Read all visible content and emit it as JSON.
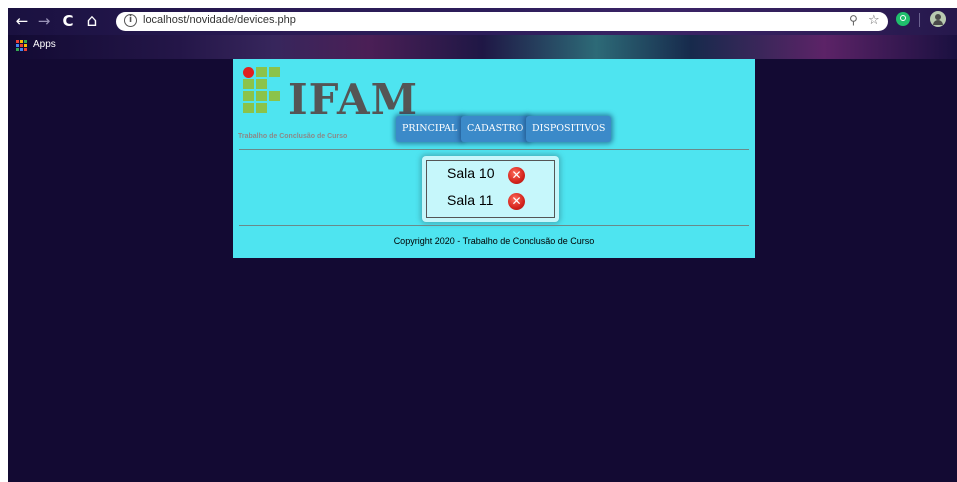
{
  "browser": {
    "url": "localhost/novidade/devices.php",
    "back_icon": "←",
    "forward_icon": "→",
    "reload_icon": "C",
    "home_icon": "⌂",
    "info_icon": "i",
    "zoom_icon": "⚲",
    "star_icon": "☆",
    "bookmarks": {
      "apps_label": "Apps"
    }
  },
  "site": {
    "logo_text": "IFAM",
    "subtitle": "Trabalho de Conclusão de Curso",
    "menu": [
      {
        "label": "PRINCIPAL"
      },
      {
        "label": "CADASTRO"
      },
      {
        "label": "DISPOSITIVOS"
      }
    ],
    "devices": [
      {
        "name": "Sala 10",
        "delete_icon": "✕"
      },
      {
        "name": "Sala 11",
        "delete_icon": "✕"
      }
    ],
    "footer": "Copyright 2020 - Trabalho de Conclusão de Curso"
  },
  "colors": {
    "page_bg": "#130a33",
    "content_bg": "#4ee4f0",
    "menu_button": "#3b8ac9",
    "logo_green": "#8bc34a",
    "logo_red": "#e02020",
    "delete_red": "#d3241c"
  }
}
